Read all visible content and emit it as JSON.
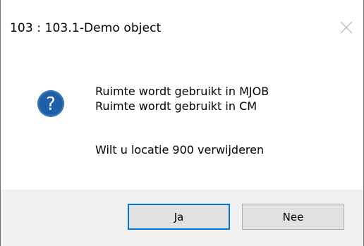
{
  "window": {
    "title": "103 : 103.1-Demo object",
    "close_icon": "close-icon"
  },
  "message": {
    "icon": "question-icon",
    "line1": "Ruimte wordt gebruikt in MJOB",
    "line2": "Ruimte wordt gebruikt in CM",
    "question": "Wilt u locatie 900 verwijderen"
  },
  "buttons": {
    "yes_label": "Ja",
    "no_label": "Nee"
  },
  "colors": {
    "icon_blue": "#1f5fa8",
    "focus_border": "#0078d7",
    "footer_bg": "#f0f0f0"
  }
}
